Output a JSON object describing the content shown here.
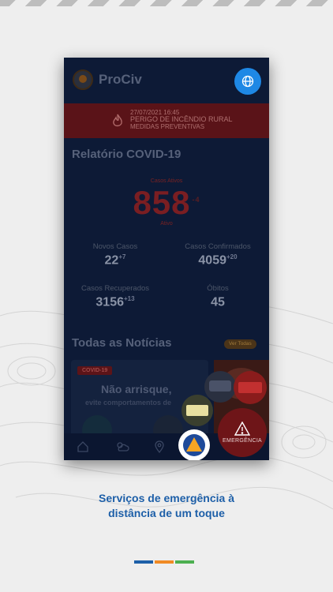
{
  "app": {
    "title": "ProCiv"
  },
  "alert": {
    "date": "27/07/2021 16:45",
    "title": "PERIGO DE INCÊNDIO RURAL",
    "subtitle": "MEDIDAS PREVENTIVAS"
  },
  "covid": {
    "title": "Relatório COVID-19",
    "active_label": "Casos Ativos",
    "active_value": "858",
    "active_delta": "-4",
    "active_note": "Ativo",
    "stats": [
      {
        "label": "Novos Casos",
        "value": "22",
        "delta": "+7"
      },
      {
        "label": "Casos Confirmados",
        "value": "4059",
        "delta": "+20"
      },
      {
        "label": "Casos Recuperados",
        "value": "3156",
        "delta": "+13"
      },
      {
        "label": "Óbitos",
        "value": "45",
        "delta": ""
      }
    ]
  },
  "news": {
    "title": "Todas as Notícias",
    "see_all": "Ver Todas",
    "card_badge": "COVID-19",
    "card_headline": "Não arrisque,",
    "card_sub": "evite comportamentos de"
  },
  "emergency": {
    "label": "EMERGÊNCIA"
  },
  "caption": {
    "line1": "Serviços de emergência à",
    "line2": "distância de um toque"
  },
  "colors": {
    "accent_blue": "#1e88e5",
    "emergency_red": "#6e1518",
    "caption_blue": "#1d5fa8",
    "bar_blue": "#1d5fa8",
    "bar_orange": "#f08a24",
    "bar_green": "#4caf50"
  },
  "icons": [
    "globe-icon",
    "fire-icon",
    "warning-icon",
    "home-icon",
    "weather-icon",
    "location-icon"
  ]
}
